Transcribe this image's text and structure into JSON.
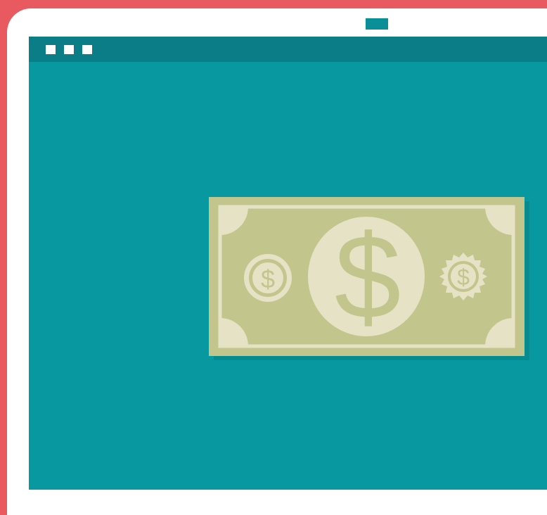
{
  "colors": {
    "frame": "#e85a60",
    "bezel": "#ffffff",
    "screen": "#07999f",
    "titlebar": "#0b7d86",
    "bill_green": "#c3c68c",
    "bill_cream": "#e6e2c6"
  },
  "window_controls": [
    "window-dot-icon",
    "window-dot-icon",
    "window-dot-icon"
  ],
  "banknote": {
    "symbol_center": "$",
    "symbol_left": "$",
    "symbol_right": "$"
  }
}
